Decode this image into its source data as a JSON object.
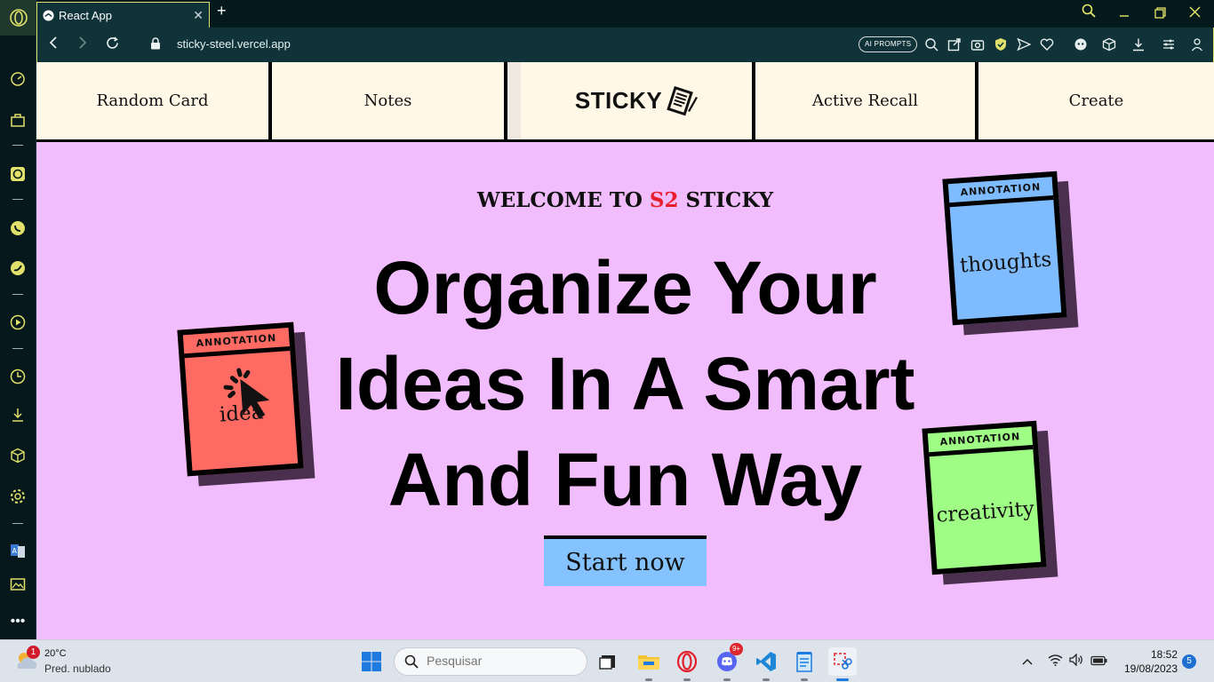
{
  "browser": {
    "tab_title": "React App",
    "url": "sticky-steel.vercel.app",
    "ai_prompts_label": "AI PROMPTS",
    "new_tab_symbol": "+",
    "close_symbol": "✕"
  },
  "nav": {
    "items": [
      "Random Card",
      "Notes",
      "STICKY",
      "Active Recall",
      "Create"
    ]
  },
  "hero": {
    "welcome_prefix": "WELCOME TO ",
    "welcome_accent": "S2",
    "welcome_suffix": " STICKY",
    "headline_lines": [
      "Organize Your",
      "Ideas In A Smart",
      "And Fun Way"
    ],
    "cta": "Start now"
  },
  "notes": [
    {
      "header": "ANNOTATION",
      "word": "idea",
      "color": "#ff6b63"
    },
    {
      "header": "ANNOTATION",
      "word": "thoughts",
      "color": "#7fbcff"
    },
    {
      "header": "ANNOTATION",
      "word": "creativity",
      "color": "#9ffd85"
    }
  ],
  "taskbar": {
    "weather_temp": "20°C",
    "weather_desc": "Pred. nublado",
    "weather_badge": "1",
    "search_placeholder": "Pesquisar",
    "discord_badge": "9+",
    "time": "18:52",
    "date": "19/08/2023",
    "notifications": "5"
  },
  "colors": {
    "page_bg": "#f2bdfc",
    "nav_card": "#fff8e6",
    "cta_bg": "#84c3ff",
    "accent_red": "#e8202e",
    "browser_accent": "#e0e06b"
  }
}
